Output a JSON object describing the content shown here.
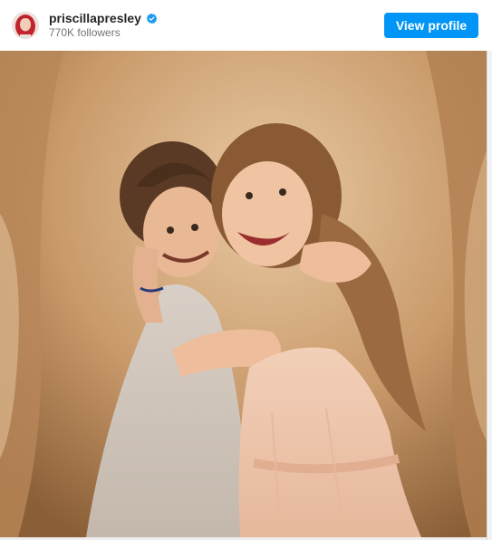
{
  "header": {
    "username": "priscillapresley",
    "followers": "770K followers",
    "view_profile_label": "View profile",
    "verified_icon": "verified-badge-icon",
    "avatar_icon": "profile-avatar"
  },
  "colors": {
    "button": "#0095f6",
    "verified": "#1d9bf0",
    "username": "#262626",
    "subtext": "#737373"
  },
  "photo": {
    "icon": "photo-two-girls-hugging"
  }
}
